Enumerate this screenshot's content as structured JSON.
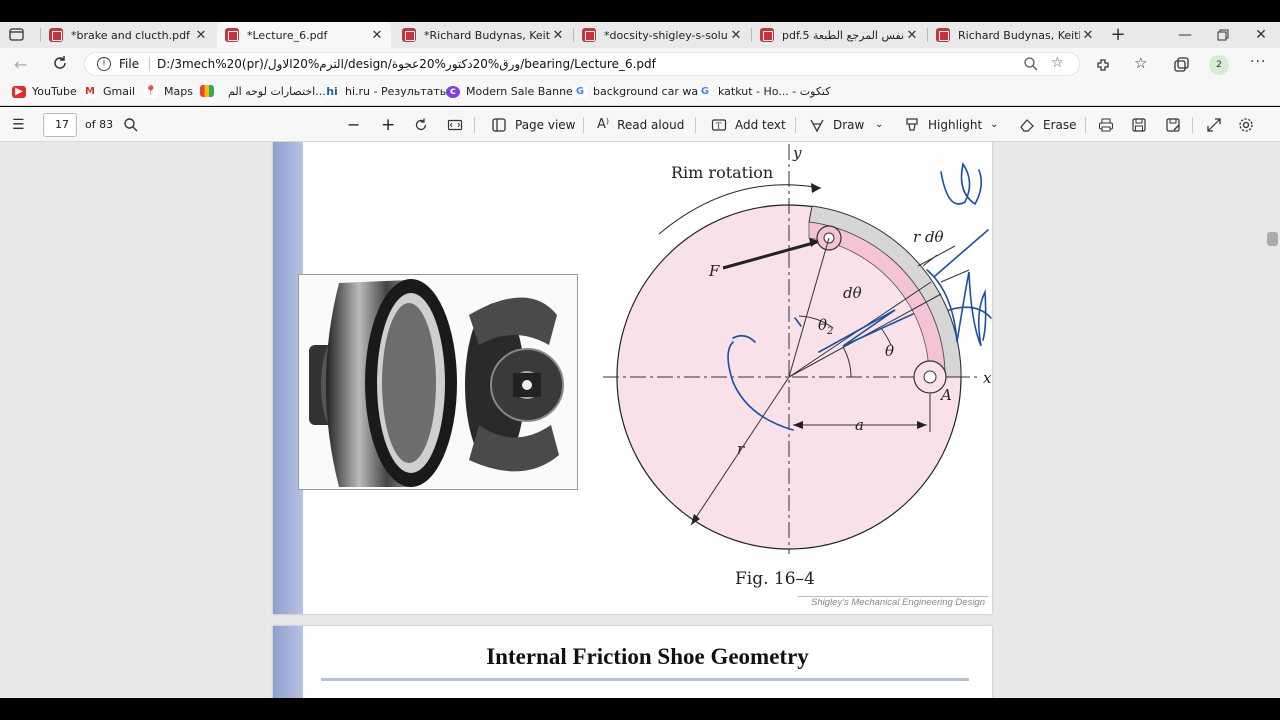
{
  "tabs": [
    {
      "title": "*brake and clucth.pdf"
    },
    {
      "title": "*Lecture_6.pdf"
    },
    {
      "title": "*Richard Budynas, Keith Nis"
    },
    {
      "title": "*docsity-shigley-s-solution-"
    },
    {
      "title": "pdf.5 نفس المرجع الطبعة"
    },
    {
      "title": "Richard Budynas, Keith Nis"
    }
  ],
  "address": {
    "scheme_label": "File",
    "url": "D:/3mech%20(pr)/الترم%20الاول/design/ورق%20دكتور%20عجوة/bearing/Lecture_6.pdf",
    "profile_badge": "2"
  },
  "bookmarks": [
    {
      "label": "YouTube",
      "icon": "youtube-icon"
    },
    {
      "label": "Gmail",
      "icon": "gmail-icon"
    },
    {
      "label": "Maps",
      "icon": "maps-icon"
    },
    {
      "label": "",
      "icon": "apps-grid-icon"
    },
    {
      "label": "اختصارات لوحه الم...",
      "icon": "none"
    },
    {
      "label": "hi.ru - Результаты...",
      "icon": "hi-icon"
    },
    {
      "label": "Modern Sale Banne...",
      "icon": "canva-icon"
    },
    {
      "label": "background car wa...",
      "icon": "google-icon"
    },
    {
      "label": "katkut - Ho... - كتكوت",
      "icon": "google-icon"
    }
  ],
  "pdf_toolbar": {
    "page_number": "17",
    "page_total": "of 83",
    "page_view": "Page view",
    "read_aloud": "Read aloud",
    "add_text": "Add text",
    "draw": "Draw",
    "highlight": "Highlight",
    "erase": "Erase"
  },
  "figure": {
    "rim_rotation": "Rim rotation",
    "caption": "Fig. 16–4",
    "footer": "Shigley's Mechanical Engineering Design",
    "labels": {
      "y": "y",
      "x": "x",
      "F": "F",
      "r_dtheta": "r dθ",
      "dtheta": "dθ",
      "theta2": "θ",
      "theta2_sub": "2",
      "theta": "θ",
      "A": "A",
      "a": "a",
      "r": "r"
    }
  },
  "next_page": {
    "heading": "Internal Friction Shoe Geometry"
  },
  "colors": {
    "disc_fill": "#f9e1e9",
    "ink_blue": "#1a4fa8",
    "pdf_red": "#c8323c"
  }
}
